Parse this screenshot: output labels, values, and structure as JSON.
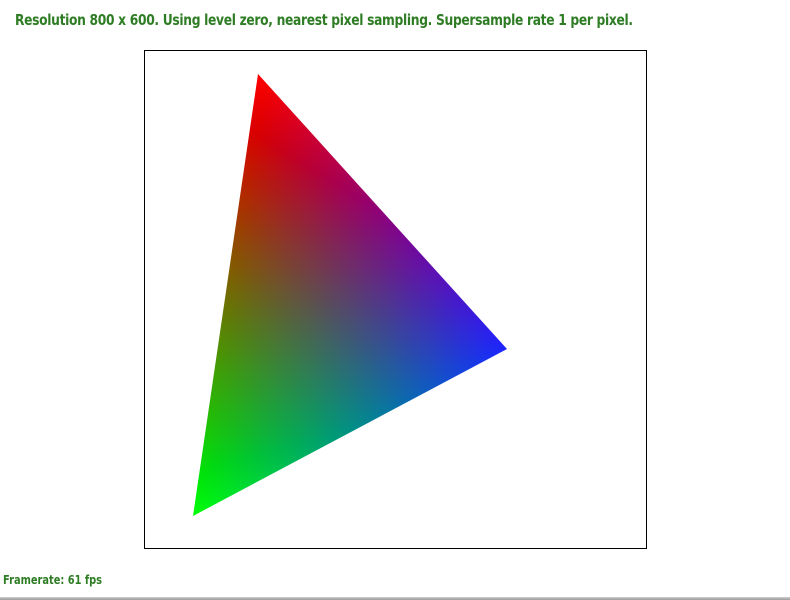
{
  "status": {
    "resolution_text": "Resolution 800 x 600. Using level zero, nearest pixel sampling. Supersample rate 1 per pixel."
  },
  "footer": {
    "framerate_text": "Framerate: 61 fps"
  },
  "colors": {
    "text": "#2e7d24",
    "vertex_top": "#ff0000",
    "vertex_right": "#0000ff",
    "vertex_bottom": "#00ff00",
    "frame_border": "#000000"
  }
}
